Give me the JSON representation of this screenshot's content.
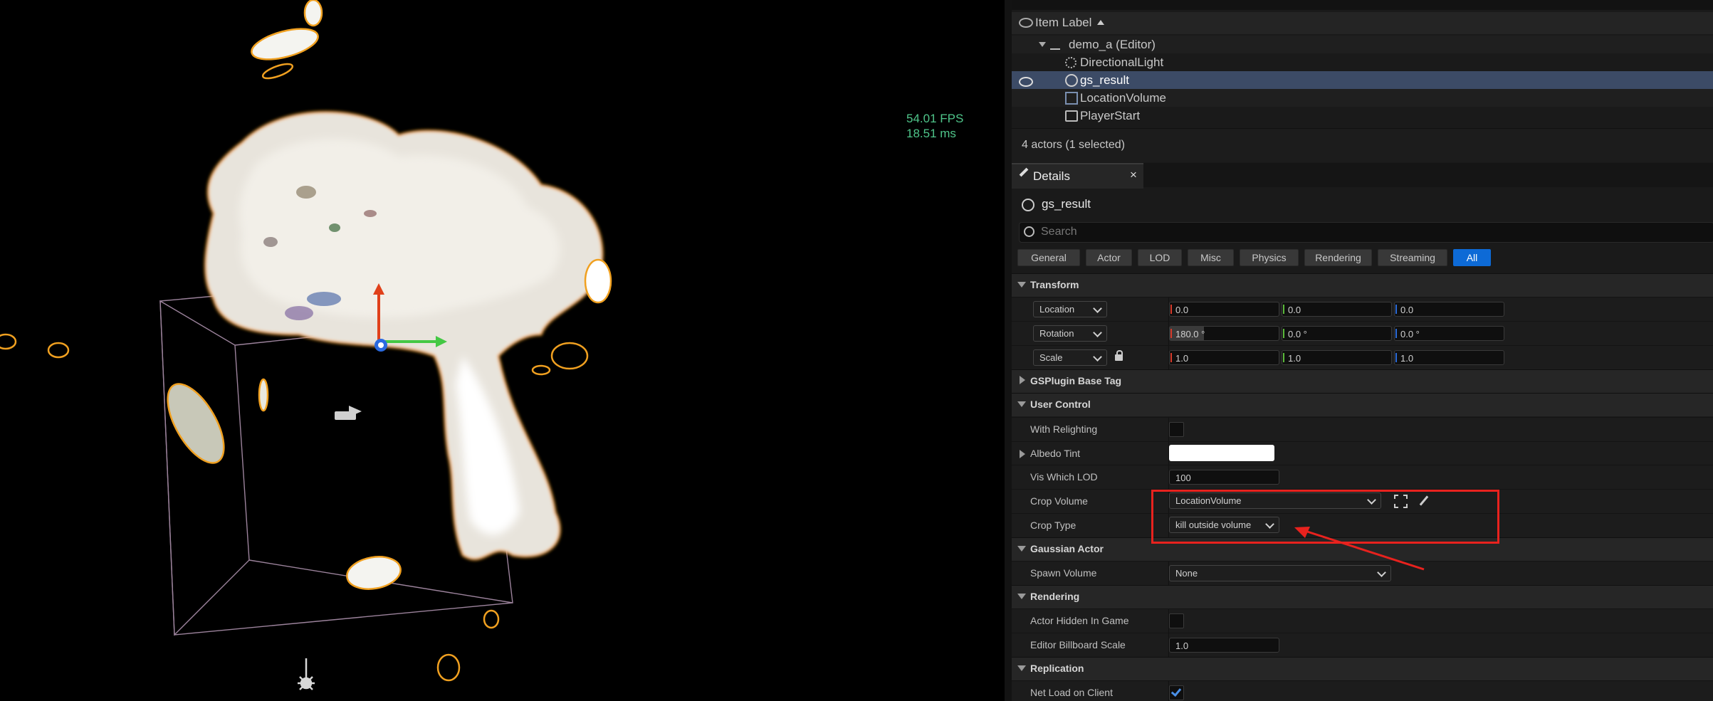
{
  "viewport": {
    "fps": "54.01 FPS",
    "ms": "18.51 ms"
  },
  "outliner": {
    "header": "Item Label",
    "items": [
      {
        "label": "demo_a (Editor)"
      },
      {
        "label": "DirectionalLight"
      },
      {
        "label": "gs_result"
      },
      {
        "label": "LocationVolume"
      },
      {
        "label": "PlayerStart"
      }
    ],
    "status": "4 actors (1 selected)"
  },
  "details": {
    "tab_label": "Details",
    "object_name": "gs_result",
    "search_placeholder": "Search",
    "filters": [
      "General",
      "Actor",
      "LOD",
      "Misc",
      "Physics",
      "Rendering",
      "Streaming",
      "All"
    ],
    "transform": {
      "title": "Transform",
      "location": {
        "label": "Location",
        "x": "0.0",
        "y": "0.0",
        "z": "0.0"
      },
      "rotation": {
        "label": "Rotation",
        "x": "180.0 °",
        "y": "0.0 °",
        "z": "0.0 °"
      },
      "scale": {
        "label": "Scale",
        "x": "1.0",
        "y": "1.0",
        "z": "1.0"
      }
    },
    "gsplugin": {
      "title": "GSPlugin Base Tag"
    },
    "user_control": {
      "title": "User Control",
      "with_relighting": "With Relighting",
      "albedo_tint": "Albedo Tint",
      "vis_lod_label": "Vis Which LOD",
      "vis_lod_value": "100",
      "crop_volume_label": "Crop Volume",
      "crop_volume_value": "LocationVolume",
      "crop_type_label": "Crop Type",
      "crop_type_value": "kill outside volume"
    },
    "gaussian_actor": {
      "title": "Gaussian Actor",
      "spawn_label": "Spawn Volume",
      "spawn_value": "None"
    },
    "rendering": {
      "title": "Rendering",
      "hidden_label": "Actor Hidden In Game",
      "billboard_label": "Editor Billboard Scale",
      "billboard_value": "1.0"
    },
    "replication": {
      "title": "Replication",
      "net_load_label": "Net Load on Client"
    }
  },
  "colors": {
    "selection": "#3c4b66",
    "accent": "#0d6ad6",
    "annotation": "#e8221e",
    "fps": "#4fc58a",
    "splat_outline": "#f0a020"
  }
}
